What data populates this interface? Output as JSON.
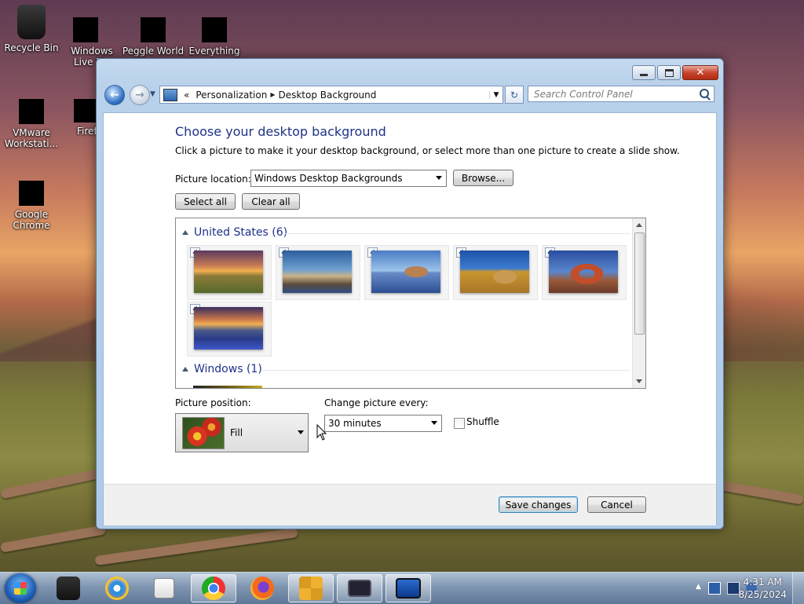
{
  "desktop": {
    "icons": [
      {
        "label": "Recycle Bin"
      },
      {
        "label": "Windows Live Ma"
      },
      {
        "label": "Peggle World"
      },
      {
        "label": "Everything"
      },
      {
        "label": "VMware Workstati..."
      },
      {
        "label": "Firef"
      },
      {
        "label": "Google Chrome"
      }
    ]
  },
  "window": {
    "title": "Desktop Background",
    "controls": {
      "minimize": "minimize",
      "maximize": "maximize",
      "close": "✕"
    },
    "breadcrumb": {
      "prefix": "«",
      "items": [
        "Personalization",
        "Desktop Background"
      ]
    },
    "search_placeholder": "Search Control Panel",
    "heading": "Choose your desktop background",
    "subtitle": "Click a picture to make it your desktop background, or select more than one picture to create a slide show.",
    "picture_location_label": "Picture location:",
    "picture_location_value": "Windows Desktop Backgrounds",
    "browse_label": "Browse...",
    "select_all_label": "Select all",
    "clear_all_label": "Clear all",
    "groups": [
      {
        "name": "United States (6)",
        "pictures": [
          {
            "name": "sunset-field",
            "checked": true
          },
          {
            "name": "lighthouse",
            "checked": true
          },
          {
            "name": "rock-reflection",
            "checked": true
          },
          {
            "name": "hay-bale",
            "checked": true
          },
          {
            "name": "delicate-arch",
            "checked": true
          },
          {
            "name": "lupine-lake",
            "checked": true
          }
        ]
      },
      {
        "name": "Windows (1)",
        "pictures": []
      }
    ],
    "picture_position_label": "Picture position:",
    "picture_position_value": "Fill",
    "change_every_label": "Change picture every:",
    "change_every_value": "30 minutes",
    "shuffle_label": "Shuffle",
    "shuffle_checked": false,
    "save_label": "Save changes",
    "cancel_label": "Cancel"
  },
  "taskbar": {
    "items": [
      "start",
      "task-manager",
      "internet-explorer",
      "media-player",
      "chrome",
      "firefox",
      "vmware",
      "remote-desktop",
      "control-panel"
    ],
    "time": "4:31 AM",
    "date": "8/25/2024"
  }
}
